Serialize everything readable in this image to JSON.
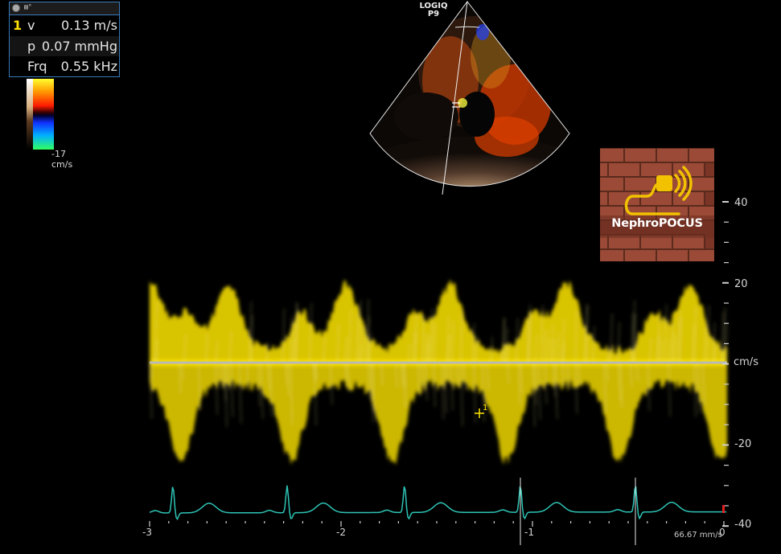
{
  "measurement_panel": {
    "header_icon": "bookmark-icon",
    "index": "1",
    "rows": [
      {
        "label": "v",
        "value": "0.13 m/s"
      },
      {
        "label": "p",
        "value": "0.07 mmHg"
      },
      {
        "label": "Frq",
        "value": "0.55 kHz"
      }
    ]
  },
  "color_bar": {
    "value": "-17",
    "unit": "cm/s"
  },
  "probe": {
    "name": "LOGIQ",
    "preset": "P9"
  },
  "logo": {
    "text": "NephroPOCUS",
    "icon": "ultrasound-probe-icon",
    "colors": {
      "brick": "#8a3d2a",
      "accent": "#f2c200"
    }
  },
  "spectrum": {
    "velocity_unit": "cm/s",
    "velocity_ticks": [
      "40",
      "20",
      "-20",
      "-40"
    ],
    "time_ticks": [
      "-3",
      "-2",
      "-1",
      "0"
    ],
    "scan_speed": "66.67 mm/s",
    "waveform_color": "#ffe600",
    "baseline_color": "#b8b8b8",
    "ecg_color": "#2ec4b6"
  }
}
